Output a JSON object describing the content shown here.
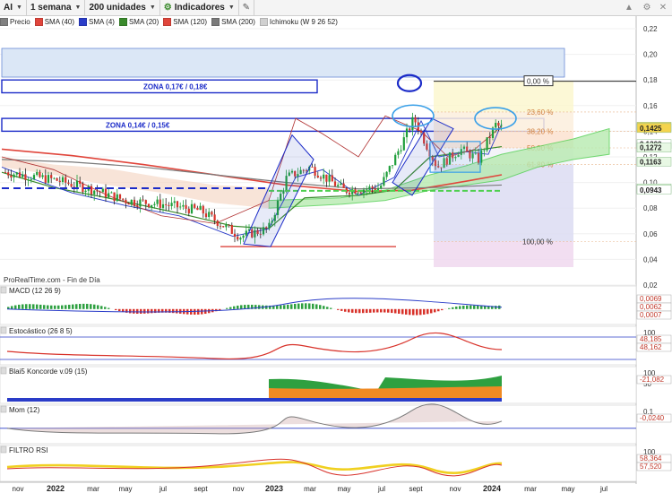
{
  "toolbar": {
    "symbol": "AI",
    "timeframe": "1 semana",
    "units": "200 unidades",
    "indicators": "Indicadores"
  },
  "legend": [
    {
      "label": "Precio",
      "color": "#7f7f7f"
    },
    {
      "label": "SMA (40)",
      "color": "#e0453b"
    },
    {
      "label": "SMA (4)",
      "color": "#2a3cc8"
    },
    {
      "label": "SMA (20)",
      "color": "#3a8a2c"
    },
    {
      "label": "SMA (120)",
      "color": "#e0453b"
    },
    {
      "label": "SMA (200)",
      "color": "#7a7a7a"
    },
    {
      "label": "Ichimoku (W 9 26 52)",
      "color": "#d0d0d0"
    }
  ],
  "colors": {
    "up": "#1e9e3a",
    "down": "#d8322a",
    "zone_box": "#1b2bc8",
    "fib_top": "#fbf7cf",
    "ichimoku_cloud": "#b7eab0"
  },
  "chart_data": {
    "type": "candlestick",
    "watermark": "ProRealTime.com - Fin de Día",
    "y_ticks": [
      0.22,
      0.2,
      0.18,
      0.16,
      0.14,
      0.12,
      0.1,
      0.08,
      0.06,
      0.04,
      0.02
    ],
    "ylim": [
      0.02,
      0.22
    ],
    "x_ticks": [
      "nov",
      "2022",
      "mar",
      "may",
      "jul",
      "sept",
      "nov",
      "2023",
      "mar",
      "may",
      "jul",
      "sept",
      "nov",
      "2024",
      "mar",
      "may",
      "jul"
    ],
    "close_path": [
      [
        "nov",
        0.108
      ],
      [
        "2022",
        0.102
      ],
      [
        "mar",
        0.094
      ],
      [
        "may",
        0.086
      ],
      [
        "jul",
        0.083
      ],
      [
        "sept",
        0.078
      ],
      [
        "nov",
        0.058
      ],
      [
        "2023",
        0.064
      ],
      [
        "2023-feb",
        0.104
      ],
      [
        "mar",
        0.112
      ],
      [
        "may",
        0.094
      ],
      [
        "jul",
        0.096
      ],
      [
        "ago",
        0.118
      ],
      [
        "sept",
        0.15
      ],
      [
        "sept-b",
        0.112
      ],
      [
        "nov",
        0.126
      ],
      [
        "dic",
        0.118
      ],
      [
        "2024",
        0.145
      ],
      [
        "ene",
        0.1425
      ]
    ],
    "zones": [
      {
        "label": "ZONA 0,17€ / 0,18€",
        "from": 0.17,
        "to": 0.18
      },
      {
        "label": "ZONA 0,14€ / 0,15€",
        "from": 0.14,
        "to": 0.15
      }
    ],
    "support_line": 0.05,
    "dashed_line": 0.0955,
    "fib_levels": [
      {
        "label": "0,00 %",
        "value": 0.179
      },
      {
        "label": "23,60 %",
        "value": 0.155
      },
      {
        "label": "38,20 %",
        "value": 0.14
      },
      {
        "label": "50,00 %",
        "value": 0.127
      },
      {
        "label": "61,80 %",
        "value": 0.114
      },
      {
        "label": "100,00 %",
        "value": 0.054
      }
    ],
    "price_labels": [
      {
        "text": "0,1435",
        "value": 0.1435,
        "color": "#f4d44d"
      },
      {
        "text": "0,1425",
        "value": 0.1425,
        "color": "#f4d44d"
      },
      {
        "text": "0,1300",
        "value": 0.13,
        "color": "#ffffff"
      },
      {
        "text": "0,1272",
        "value": 0.1272,
        "color": "#e8f8e4"
      },
      {
        "text": "0,1163",
        "value": 0.1163,
        "color": "#e8f8e4"
      },
      {
        "text": "0,0954",
        "value": 0.0954,
        "color": "#e8f8e4"
      },
      {
        "text": "0,0943",
        "value": 0.0943,
        "color": "#ffffff"
      }
    ]
  },
  "panels": [
    {
      "name": "MACD (12 26 9)",
      "labels": [
        "0,0069",
        "0,0062",
        "0,0007"
      ],
      "ticks": []
    },
    {
      "name": "Estocástico (26 8 5)",
      "labels": [
        "48,185",
        "48,162"
      ],
      "ticks": [
        "100"
      ]
    },
    {
      "name": "Blai5 Koncorde v.09 (15)",
      "labels": [
        "-21,082"
      ],
      "ticks": [
        "100",
        "50"
      ]
    },
    {
      "name": "Mom (12)",
      "labels": [
        "-0,0240"
      ],
      "ticks": [
        "0,1"
      ]
    },
    {
      "name": "FILTRO RSI",
      "labels": [
        "58,364",
        "57,520"
      ],
      "ticks": [
        "100"
      ]
    }
  ]
}
